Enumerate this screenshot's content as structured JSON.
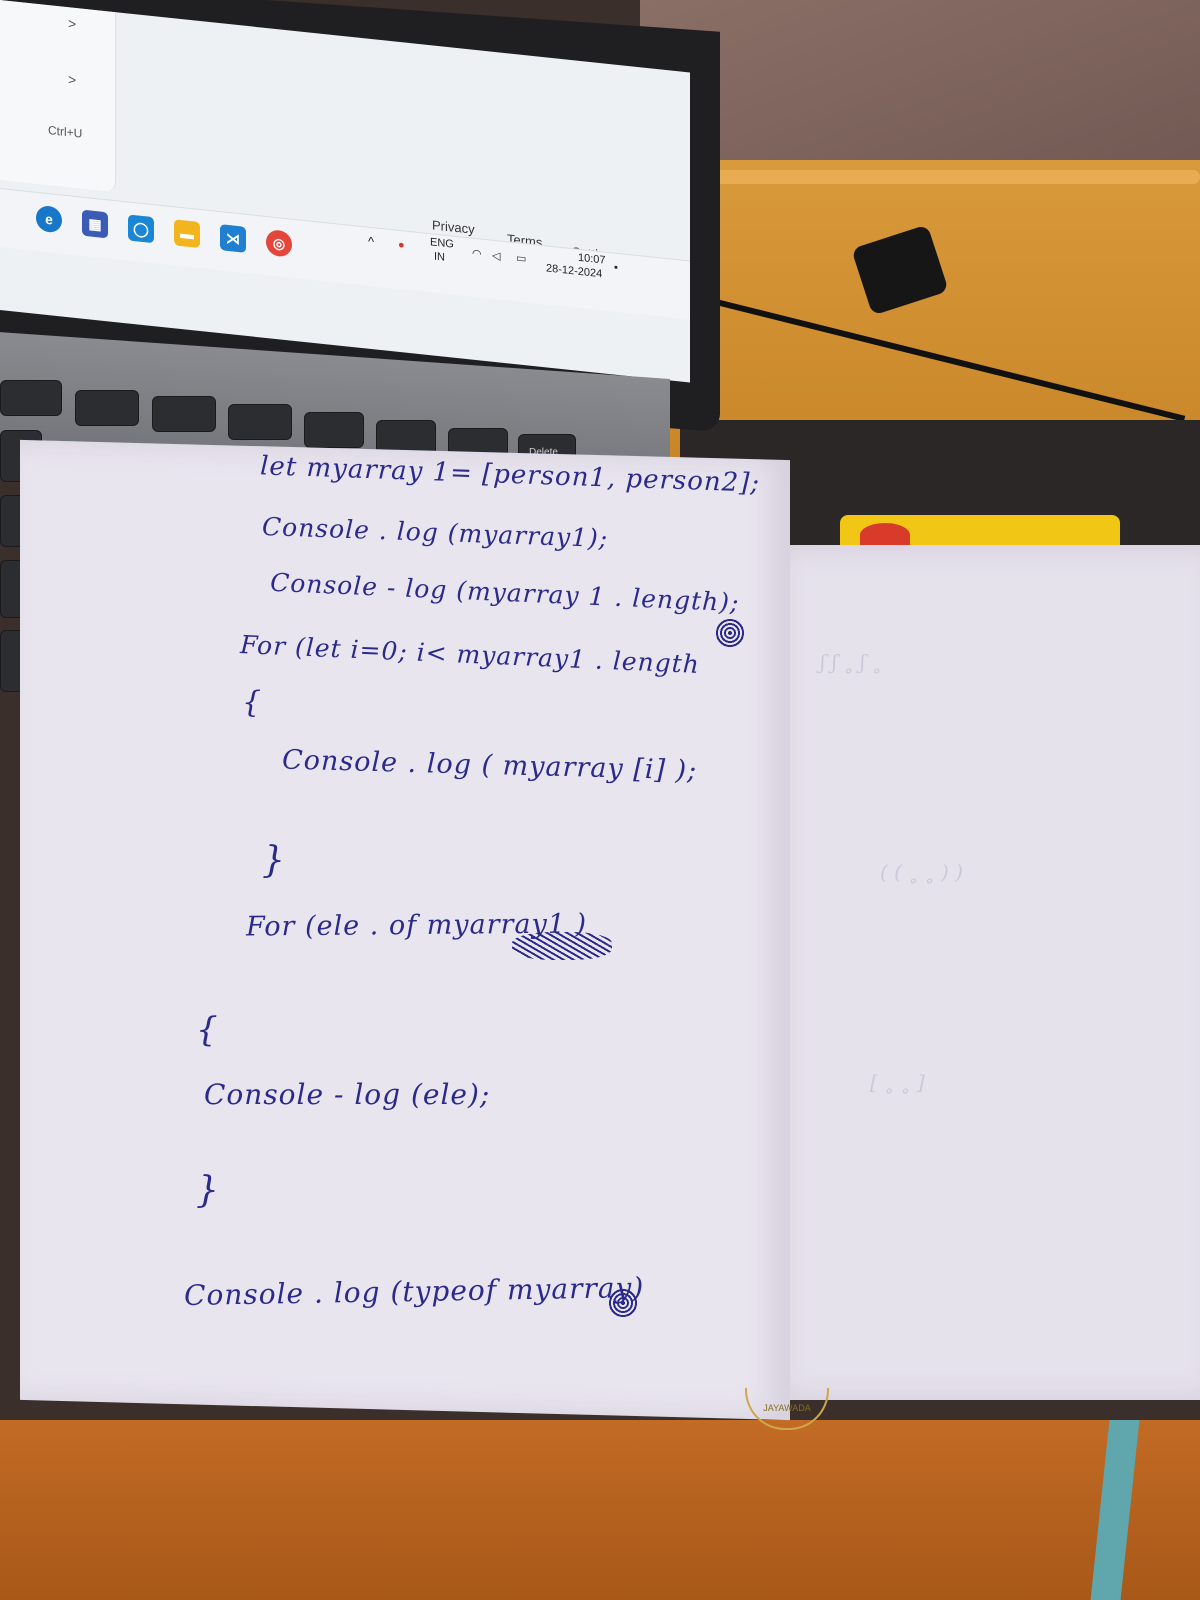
{
  "screen": {
    "menu": {
      "chevrons": [
        ">",
        ">"
      ],
      "shortcut": "Ctrl+U"
    },
    "links": {
      "privacy": "Privacy",
      "terms": "Terms",
      "settings": "Settings"
    },
    "taskbar": {
      "language_top": "ENG",
      "language_bottom": "IN",
      "time": "10:07",
      "date": "28-12-2024",
      "icons": [
        "edge-icon",
        "store-icon",
        "app-icon",
        "file-explorer-icon",
        "vscode-icon",
        "chrome-icon"
      ]
    }
  },
  "keyboard": {
    "delete_key": "Delete"
  },
  "notebook": {
    "lines": [
      "let myarray 1= [person1, person2];",
      "Console . log (myarray1);",
      "Console - log (myarray 1 . length);",
      "For (let    i=0; i< myarray1 . length",
      "{",
      "Console . log ( myarray [i] );",
      "}",
      "For (ele . of myarray1 )",
      "{",
      "Console - log (ele);",
      "}",
      "Console . log (typeof myarray)"
    ]
  },
  "stamp": {
    "text": "JAYAWADA"
  },
  "colors": {
    "ink": "#2b2a8a",
    "paper": "#e9e5ef",
    "shelf": "#d99a3c",
    "label_yellow": "#f2c614"
  }
}
